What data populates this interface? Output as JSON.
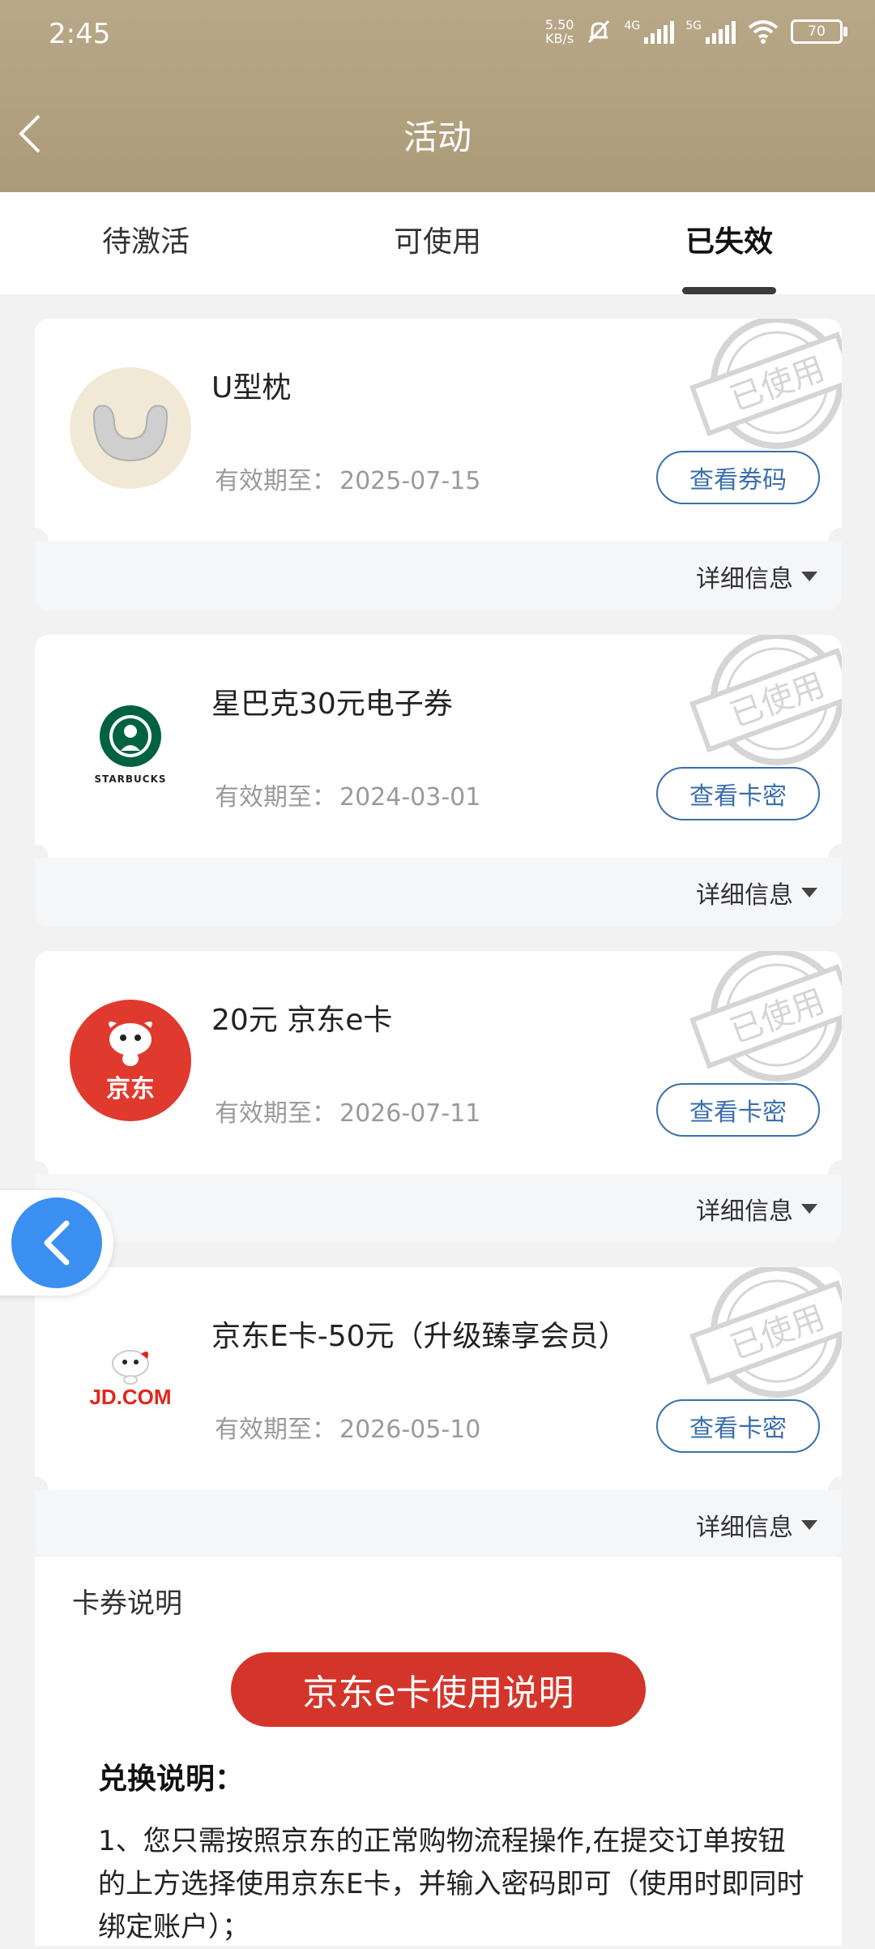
{
  "status_bar": {
    "time": "2:45",
    "net_speed_top": "5.50",
    "net_speed_bottom": "KB/s",
    "sig1_label": "4G",
    "sig2_label": "5G",
    "battery": "70"
  },
  "header": {
    "title": "活动"
  },
  "tabs": [
    {
      "label": "待激活"
    },
    {
      "label": "可使用"
    },
    {
      "label": "已失效"
    }
  ],
  "active_tab": "已失效",
  "cards": [
    {
      "name": "U型枕",
      "expiry_label": "有效期至：",
      "expiry": "2025-07-15",
      "button": "查看券码",
      "detail": "详细信息",
      "stamp": "已使用",
      "logo_icon": "neck-pillow-icon"
    },
    {
      "name": "星巴克30元电子券",
      "expiry_label": "有效期至：",
      "expiry": "2024-03-01",
      "button": "查看卡密",
      "detail": "详细信息",
      "stamp": "已使用",
      "logo_icon": "starbucks-logo",
      "logo_text": "STARBUCKS"
    },
    {
      "name": "20元 京东e卡",
      "expiry_label": "有效期至：",
      "expiry": "2026-07-11",
      "button": "查看卡密",
      "detail": "详细信息",
      "stamp": "已使用",
      "logo_icon": "jd-dog-logo",
      "logo_text": "京东"
    },
    {
      "name": "京东E卡-50元（升级臻享会员）",
      "expiry_label": "有效期至：",
      "expiry": "2026-05-10",
      "button": "查看卡密",
      "detail": "详细信息",
      "stamp": "已使用",
      "logo_icon": "jd-com-logo",
      "logo_text": "JD.COM"
    }
  ],
  "description": {
    "title": "卡券说明",
    "banner": "京东e卡使用说明",
    "subtitle": "兑换说明：",
    "body": "1、您只需按照京东的正常购物流程操作,在提交订单按钮的上方选择使用京东E卡，并输入密码即可（使用时即同时绑定账户）；"
  },
  "colors": {
    "header": "#b09f7c",
    "accent_blue": "#3b6fad",
    "banner_red": "#d4352b",
    "float_blue": "#3a8ff0"
  }
}
